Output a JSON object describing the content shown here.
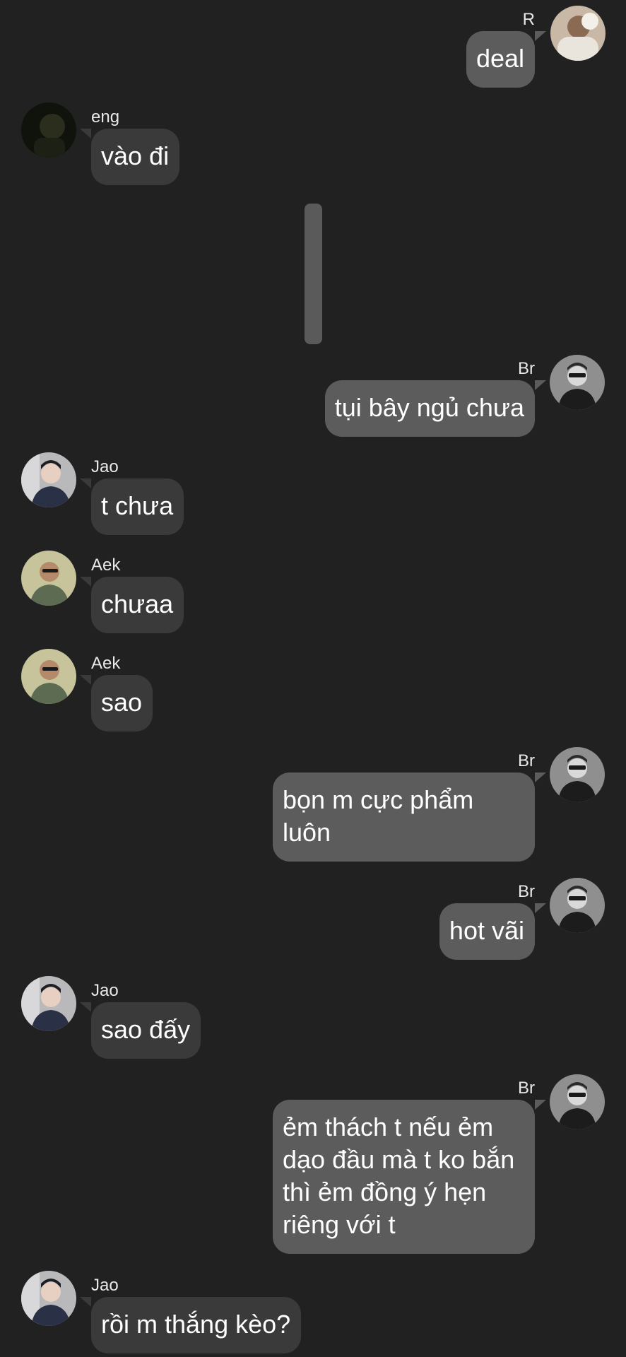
{
  "messages": [
    {
      "sender": "R",
      "text": "deal",
      "direction": "outgoing",
      "avatar": "avatar-r"
    },
    {
      "sender": "eng",
      "text": "vào đi",
      "direction": "incoming",
      "avatar": "avatar-eng"
    },
    {
      "sender": "Br",
      "text": "tụi bây ngủ chưa",
      "direction": "outgoing",
      "avatar": "avatar-br"
    },
    {
      "sender": "Jao",
      "text": "t chưa",
      "direction": "incoming",
      "avatar": "avatar-jao"
    },
    {
      "sender": "Aek",
      "text": "chưaa",
      "direction": "incoming",
      "avatar": "avatar-aek"
    },
    {
      "sender": "Aek",
      "text": "sao",
      "direction": "incoming",
      "avatar": "avatar-aek"
    },
    {
      "sender": "Br",
      "text": "bọn m cực phẩm luôn",
      "direction": "outgoing",
      "avatar": "avatar-br"
    },
    {
      "sender": "Br",
      "text": "hot vãi",
      "direction": "outgoing",
      "avatar": "avatar-br"
    },
    {
      "sender": "Jao",
      "text": "sao đấy",
      "direction": "incoming",
      "avatar": "avatar-jao"
    },
    {
      "sender": "Br",
      "text": "ẻm thách t nếu ẻm dạo đầu mà t ko bắn thì ẻm đồng ý hẹn riêng với t",
      "direction": "outgoing",
      "avatar": "avatar-br"
    },
    {
      "sender": "Jao",
      "text": "rồi m thắng kèo?",
      "direction": "incoming",
      "avatar": "avatar-jao"
    }
  ],
  "colors": {
    "background": "#212121",
    "incoming_bubble": "#3a3a3a",
    "outgoing_bubble": "#5c5c5c",
    "text": "#ffffff"
  }
}
